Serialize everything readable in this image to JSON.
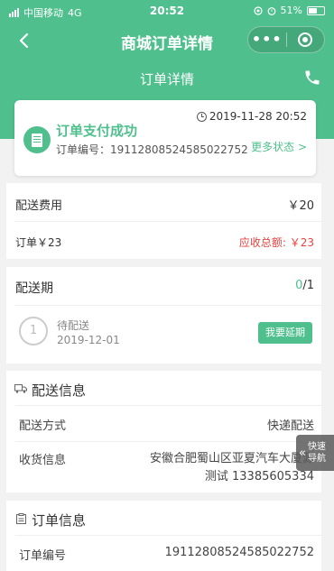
{
  "status_bar": {
    "carrier": "中国移动",
    "network": "4G",
    "time": "20:52",
    "battery": "51%"
  },
  "nav": {
    "title": "商城订单详情",
    "more_glyph": "•••",
    "back_icon": "chevron-left-icon",
    "close_icon": "target-circle-icon"
  },
  "header": {
    "subtitle": "订单详情",
    "phone_icon": "phone-icon"
  },
  "status_card": {
    "datetime": "2019-11-28 20:52",
    "title": "订单支付成功",
    "order_no_label": "订单编号：",
    "order_no": "19112808524585022752",
    "more_status": "更多状态 >"
  },
  "fees": {
    "label": "配送费用",
    "value": "￥20",
    "order_amount": "订单￥23",
    "receivable_label": "应收总额:",
    "receivable_value": "￥23"
  },
  "period": {
    "title": "配送期",
    "done": "0",
    "total": "/1",
    "step_number": "1",
    "step_status": "待配送",
    "step_date": "2019-12-01",
    "extend_button": "我要延期"
  },
  "delivery": {
    "title": "配送信息",
    "method_label": "配送方式",
    "method_value": "快递配送",
    "receiver_label": "收货信息",
    "address": "安徽合肥蜀山区亚夏汽车大厦源",
    "contact": "测试 13385605334"
  },
  "order_info": {
    "title": "订单信息",
    "order_no_label": "订单编号",
    "order_no": "19112808524585022752"
  },
  "quick_nav": {
    "line1": "快速",
    "line2": "导航"
  },
  "colors": {
    "brand": "#4fc08d",
    "price_red": "#e64340"
  }
}
